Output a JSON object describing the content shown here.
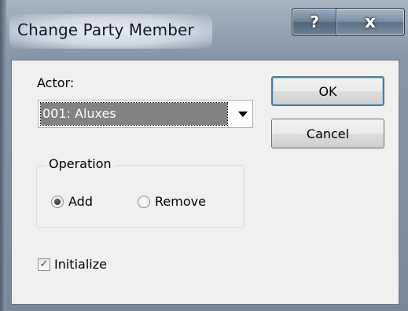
{
  "window": {
    "title": "Change Party Member",
    "help_label": "?",
    "close_label": "x"
  },
  "actor": {
    "label": "Actor:",
    "selected": "001: Aluxes"
  },
  "buttons": {
    "ok": "OK",
    "cancel": "Cancel"
  },
  "operation": {
    "title": "Operation",
    "options": [
      {
        "label": "Add",
        "checked": true
      },
      {
        "label": "Remove",
        "checked": false
      }
    ]
  },
  "initialize": {
    "label": "Initialize",
    "checked": true,
    "check_glyph": "✓"
  }
}
